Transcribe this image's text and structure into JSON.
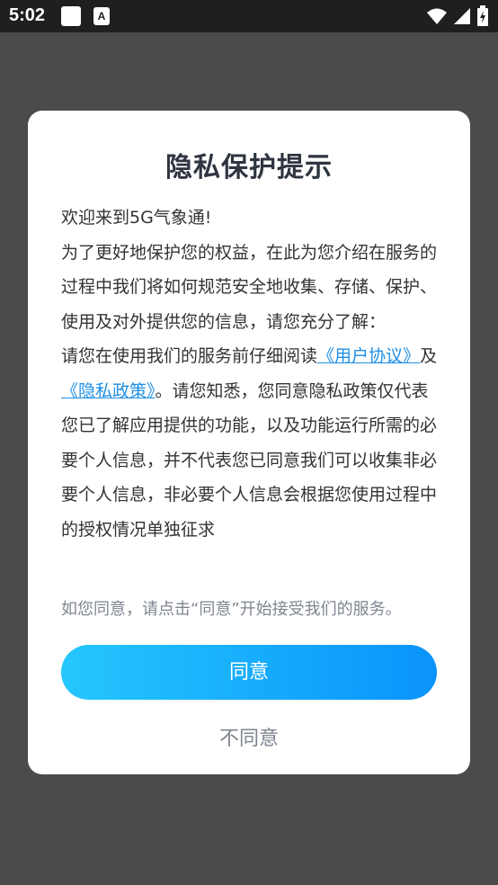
{
  "status_bar": {
    "time": "5:02",
    "icons": [
      "notification-square-icon",
      "keyboard-a-icon",
      "wifi-icon",
      "signal-icon",
      "battery-icon"
    ],
    "keyboard_icon_letter": "A"
  },
  "dialog": {
    "title": "隐私保护提示",
    "welcome": "欢迎来到5G气象通!",
    "para1": "为了更好地保护您的权益，在此为您介绍在服务的过程中我们将如何规范安全地收集、存储、保护、使用及对外提供您的信息，请您充分了解：",
    "para2_prefix": "请您在使用我们的服务前仔细阅读",
    "user_agreement_link": "《用户协议》",
    "and": "及",
    "privacy_policy_link": "《隐私政策》",
    "para2_suffix": "。请您知悉，您同意隐私政策仅代表您已了解应用提供的功能，以及功能运行所需的必要个人信息，并不代表您已同意我们可以收集非必要个人信息，非必要个人信息会根据您使用过程中的授权情况单独征求",
    "consent_note": "如您同意，请点击“同意”开始接受我们的服务。",
    "agree_label": "同意",
    "disagree_label": "不同意"
  },
  "colors": {
    "overlay": "#4b4b4b",
    "link": "#1e8fe6",
    "button_gradient_start": "#25c7fd",
    "button_gradient_end": "#0a93fb"
  }
}
